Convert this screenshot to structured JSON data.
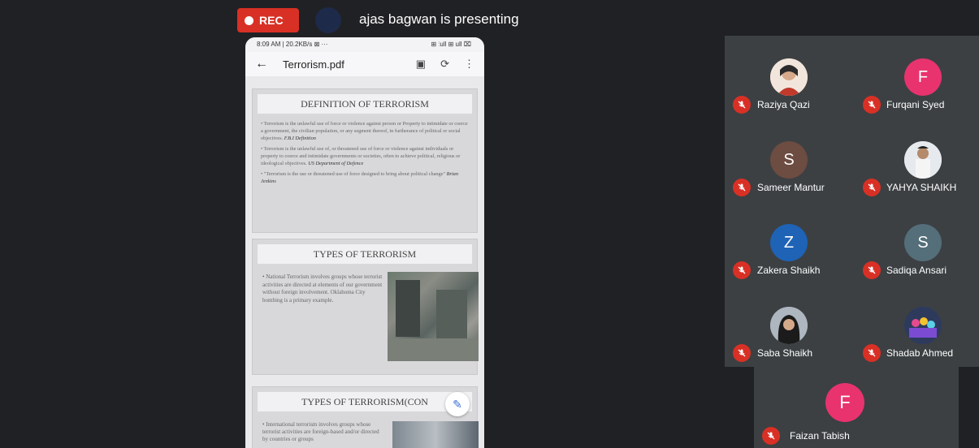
{
  "meeting": {
    "rec_label": "REC",
    "presenting_text": "ajas bagwan is presenting"
  },
  "phone": {
    "status_left": "8:09 AM | 20.2KB/s ⊠ ···",
    "status_right": "⊞ ⫶ull ⊞ ull ⌧",
    "file_title": "Terrorism.pdf"
  },
  "slides": [
    {
      "heading": "DEFINITION OF TERRORISM",
      "paragraphs": [
        "• Terrorism is the unlawful use of force or violence against person or Property to intimidate or coerce a government, the civilian population, or any segment thereof, in furtherance of political or social objectives.",
        "• Terrorism is the unlawful use of, or threatened use of force or violence against individuals or property to coerce and intimidate governments or societies, often to achieve political, religious or ideological objectives.",
        "• \"Terrorism is the use or threatened use of force designed to bring about political change\""
      ],
      "attributions": [
        "F.B.I Definition",
        "US Department of Defence",
        "Brian Jenkins"
      ]
    },
    {
      "heading": "TYPES OF TERRORISM",
      "text": "• National Terrorism involves groups whose terrorist activities are directed at elements of our government without foreign involvement. Oklahoma City bombing is a primary example."
    },
    {
      "heading": "TYPES OF TERRORISM(CON",
      "text": "• International terrorism involves groups whose terrorist activities are foreign-based and/or directed by countries or groups"
    }
  ],
  "participants": [
    {
      "name": "Raziya Qazi",
      "initial": "",
      "color": "#c9b3a6"
    },
    {
      "name": "Furqani Syed",
      "initial": "F",
      "color": "#e8336e"
    },
    {
      "name": "Sameer Mantur",
      "initial": "S",
      "color": "#6d4c41"
    },
    {
      "name": "YAHYA SHAIKH",
      "initial": "",
      "color": "#d9dde3"
    },
    {
      "name": "Zakera Shaikh",
      "initial": "Z",
      "color": "#1e63b6"
    },
    {
      "name": "Sadiqa Ansari",
      "initial": "S",
      "color": "#546e7a"
    },
    {
      "name": "Saba Shaikh",
      "initial": "",
      "color": "#8d97a3"
    },
    {
      "name": "Shadab Ahmed",
      "initial": "",
      "color": "#3a4a6a"
    },
    {
      "name": "Faizan Tabish",
      "initial": "F",
      "color": "#e8336e"
    }
  ],
  "icons": {
    "rec": "record-dot-icon",
    "mic_off": "mic-off-icon",
    "back": "arrow-back-icon",
    "edit": "pencil-icon"
  },
  "colors": {
    "background": "#202124",
    "tile": "#3c4043",
    "rec": "#d93025",
    "mic_off": "#d93025"
  }
}
